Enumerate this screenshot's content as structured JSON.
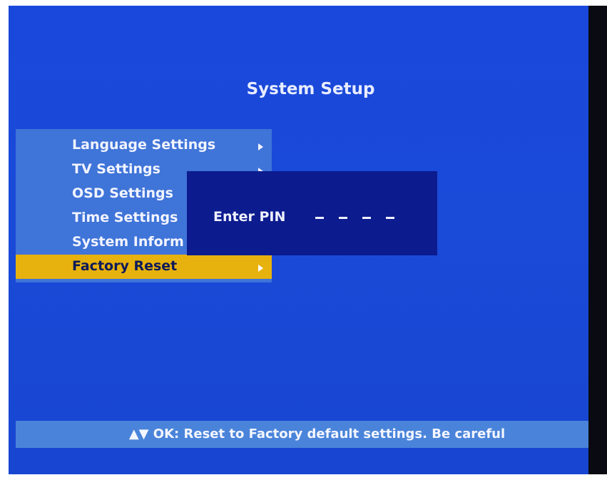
{
  "screen": {
    "title": "System Setup"
  },
  "menu": {
    "items": [
      {
        "label": "Language Settings",
        "has_submenu": true,
        "selected": false
      },
      {
        "label": "TV Settings",
        "has_submenu": true,
        "selected": false
      },
      {
        "label": "OSD Settings",
        "has_submenu": true,
        "selected": false
      },
      {
        "label": "Time Settings",
        "has_submenu": true,
        "selected": false
      },
      {
        "label": "System Inform",
        "has_submenu": true,
        "selected": false
      },
      {
        "label": "Factory Reset",
        "has_submenu": true,
        "selected": true
      }
    ]
  },
  "pin_dialog": {
    "label": "Enter PIN",
    "digits": [
      "-",
      "-",
      "-",
      "-"
    ]
  },
  "help_bar": {
    "text": "▲▼ OK: Reset to Factory default settings. Be careful"
  },
  "colors": {
    "background": "#1a48dc",
    "menu_panel": "#3f74d8",
    "selection": "#e8b20e",
    "dialog": "#0c1b8e",
    "help_bar": "#4a84da"
  }
}
